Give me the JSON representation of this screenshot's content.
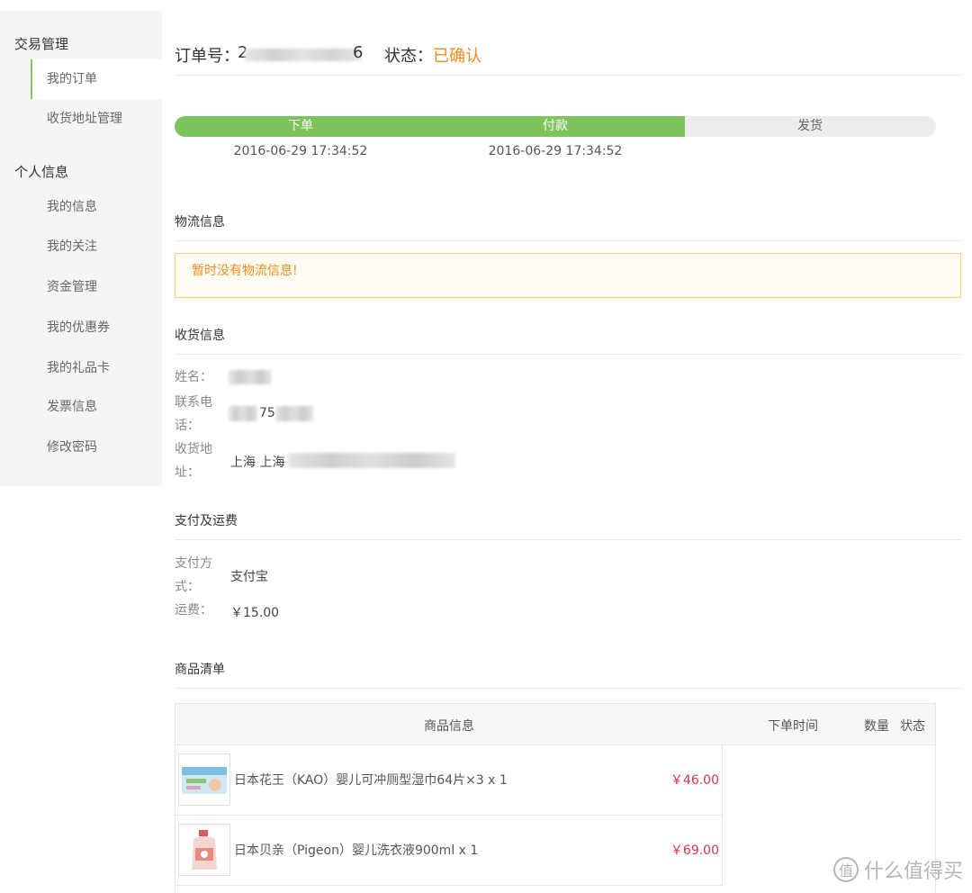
{
  "sidebar": {
    "group1": "交易管理",
    "group1_items": [
      "我的订单",
      "收货地址管理"
    ],
    "group2": "个人信息",
    "group2_items": [
      "我的信息",
      "我的关注",
      "资金管理",
      "我的优惠券",
      "我的礼品卡",
      "发票信息",
      "修改密码"
    ]
  },
  "order": {
    "number_label": "订单号：",
    "number_visible_start": "2",
    "number_visible_end": "6",
    "status_label": "状态：",
    "status_value": "已确认"
  },
  "progress": {
    "steps": [
      "下单",
      "付款",
      "发货"
    ],
    "times": [
      "2016-06-29 17:34:52",
      "2016-06-29 17:34:52"
    ],
    "completed_steps": 2,
    "fill_fraction": 0.67
  },
  "logistics": {
    "title": "物流信息",
    "notice": "暂时没有物流信息!"
  },
  "receiver": {
    "title": "收货信息",
    "name_label": "姓名：",
    "phone_label_1": "联系电",
    "phone_label_2": "话：",
    "phone_partial": "75",
    "address_label_1": "收货地",
    "address_label_2": "址：",
    "address_prefix": "上海 上海"
  },
  "payment": {
    "title": "支付及运费",
    "method_label_1": "支付方",
    "method_label_2": "式：",
    "method_value": "支付宝",
    "freight_label": "运费：",
    "freight_value": "￥15.00"
  },
  "goods": {
    "title": "商品清单",
    "headers": {
      "info": "商品信息",
      "time": "下单时间",
      "qty": "数量",
      "status": "状态"
    },
    "items": [
      {
        "name": "日本花王（KAO）婴儿可冲厕型湿巾64片×3 x 1",
        "price": "￥46.00"
      },
      {
        "name": "日本贝亲（Pigeon）婴儿洗衣液900ml x 1",
        "price": "￥69.00"
      }
    ]
  },
  "watermark": {
    "text": "什么值得买",
    "icon_text": "值"
  },
  "colors": {
    "accent_green": "#7dc55a",
    "status_orange": "#f08a1c",
    "price_red": "#d9334a",
    "notice_border": "#f2d27c"
  }
}
